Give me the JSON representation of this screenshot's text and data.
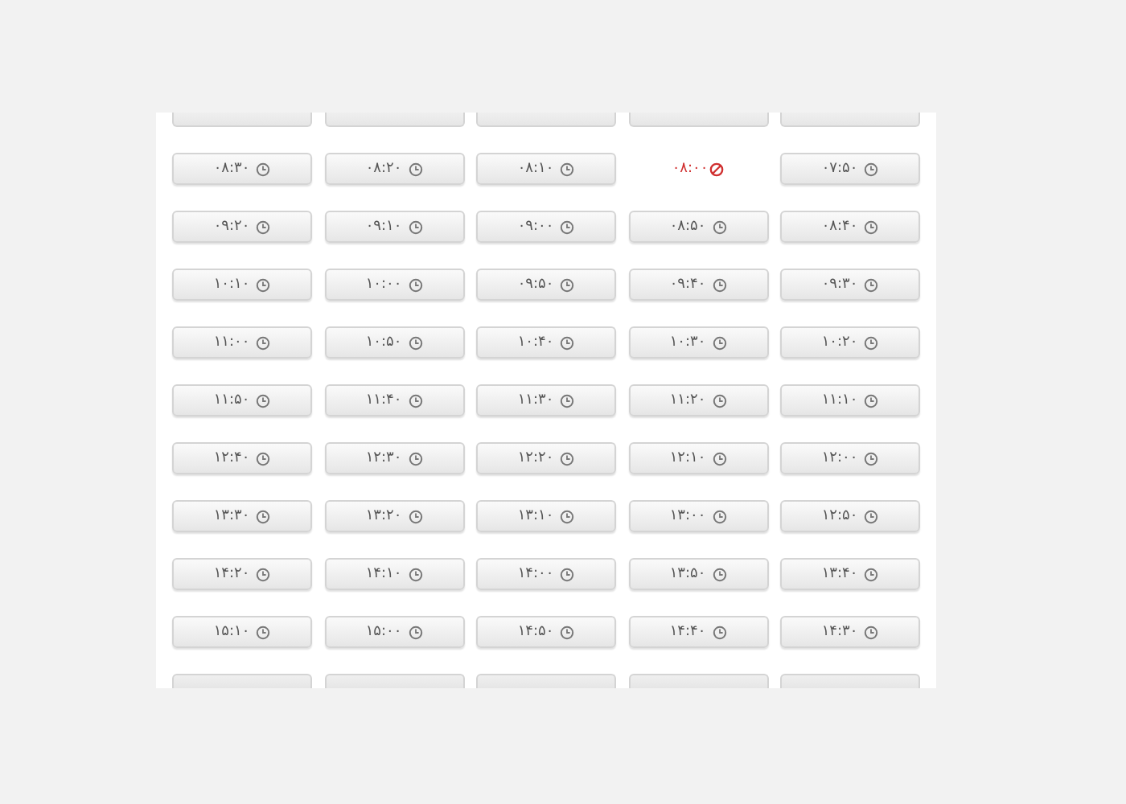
{
  "time_slots": [
    {
      "kind": "cut"
    },
    {
      "kind": "cut"
    },
    {
      "kind": "cut"
    },
    {
      "kind": "cut"
    },
    {
      "kind": "cut"
    },
    {
      "kind": "time",
      "time": "۰۷:۵۰",
      "disabled": false
    },
    {
      "kind": "time",
      "time": "۰۸:۰۰",
      "disabled": true
    },
    {
      "kind": "time",
      "time": "۰۸:۱۰",
      "disabled": false
    },
    {
      "kind": "time",
      "time": "۰۸:۲۰",
      "disabled": false
    },
    {
      "kind": "time",
      "time": "۰۸:۳۰",
      "disabled": false
    },
    {
      "kind": "time",
      "time": "۰۸:۴۰",
      "disabled": false
    },
    {
      "kind": "time",
      "time": "۰۸:۵۰",
      "disabled": false
    },
    {
      "kind": "time",
      "time": "۰۹:۰۰",
      "disabled": false
    },
    {
      "kind": "time",
      "time": "۰۹:۱۰",
      "disabled": false
    },
    {
      "kind": "time",
      "time": "۰۹:۲۰",
      "disabled": false
    },
    {
      "kind": "time",
      "time": "۰۹:۳۰",
      "disabled": false
    },
    {
      "kind": "time",
      "time": "۰۹:۴۰",
      "disabled": false
    },
    {
      "kind": "time",
      "time": "۰۹:۵۰",
      "disabled": false
    },
    {
      "kind": "time",
      "time": "۱۰:۰۰",
      "disabled": false
    },
    {
      "kind": "time",
      "time": "۱۰:۱۰",
      "disabled": false
    },
    {
      "kind": "time",
      "time": "۱۰:۲۰",
      "disabled": false
    },
    {
      "kind": "time",
      "time": "۱۰:۳۰",
      "disabled": false
    },
    {
      "kind": "time",
      "time": "۱۰:۴۰",
      "disabled": false
    },
    {
      "kind": "time",
      "time": "۱۰:۵۰",
      "disabled": false
    },
    {
      "kind": "time",
      "time": "۱۱:۰۰",
      "disabled": false
    },
    {
      "kind": "time",
      "time": "۱۱:۱۰",
      "disabled": false
    },
    {
      "kind": "time",
      "time": "۱۱:۲۰",
      "disabled": false
    },
    {
      "kind": "time",
      "time": "۱۱:۳۰",
      "disabled": false
    },
    {
      "kind": "time",
      "time": "۱۱:۴۰",
      "disabled": false
    },
    {
      "kind": "time",
      "time": "۱۱:۵۰",
      "disabled": false
    },
    {
      "kind": "time",
      "time": "۱۲:۰۰",
      "disabled": false
    },
    {
      "kind": "time",
      "time": "۱۲:۱۰",
      "disabled": false
    },
    {
      "kind": "time",
      "time": "۱۲:۲۰",
      "disabled": false
    },
    {
      "kind": "time",
      "time": "۱۲:۳۰",
      "disabled": false
    },
    {
      "kind": "time",
      "time": "۱۲:۴۰",
      "disabled": false
    },
    {
      "kind": "time",
      "time": "۱۲:۵۰",
      "disabled": false
    },
    {
      "kind": "time",
      "time": "۱۳:۰۰",
      "disabled": false
    },
    {
      "kind": "time",
      "time": "۱۳:۱۰",
      "disabled": false
    },
    {
      "kind": "time",
      "time": "۱۳:۲۰",
      "disabled": false
    },
    {
      "kind": "time",
      "time": "۱۳:۳۰",
      "disabled": false
    },
    {
      "kind": "time",
      "time": "۱۳:۴۰",
      "disabled": false
    },
    {
      "kind": "time",
      "time": "۱۳:۵۰",
      "disabled": false
    },
    {
      "kind": "time",
      "time": "۱۴:۰۰",
      "disabled": false
    },
    {
      "kind": "time",
      "time": "۱۴:۱۰",
      "disabled": false
    },
    {
      "kind": "time",
      "time": "۱۴:۲۰",
      "disabled": false
    },
    {
      "kind": "time",
      "time": "۱۴:۳۰",
      "disabled": false
    },
    {
      "kind": "time",
      "time": "۱۴:۴۰",
      "disabled": false
    },
    {
      "kind": "time",
      "time": "۱۴:۵۰",
      "disabled": false
    },
    {
      "kind": "time",
      "time": "۱۵:۰۰",
      "disabled": false
    },
    {
      "kind": "time",
      "time": "۱۵:۱۰",
      "disabled": false
    },
    {
      "kind": "cut"
    },
    {
      "kind": "cut"
    },
    {
      "kind": "cut"
    },
    {
      "kind": "cut"
    },
    {
      "kind": "cut"
    }
  ]
}
